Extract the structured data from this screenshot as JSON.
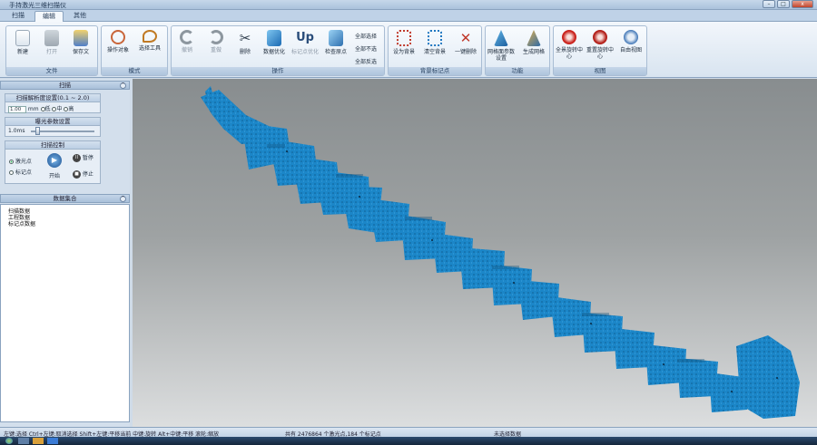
{
  "window": {
    "title": "手持激光三维扫描仪",
    "min": "–",
    "max": "□",
    "close": "x"
  },
  "tabs": [
    {
      "label": "扫描"
    },
    {
      "label": "编辑"
    },
    {
      "label": "其他"
    }
  ],
  "ribbon": {
    "groups": {
      "file": "文件",
      "mode": "模式",
      "operate": "操作",
      "bgmark": "背景标记点",
      "function": "功能",
      "view": "视图"
    },
    "file": {
      "new": "新建",
      "open": "打开",
      "save": "保存文"
    },
    "mode": {
      "operate_object": "操作对象",
      "select_tool": "选择工具"
    },
    "operate": {
      "undo": "撤销",
      "redo": "重做",
      "delete": "删除",
      "optimize": "数据优化",
      "mark_optimize": "标记点优化",
      "detect_prime": "检查原点",
      "full_select": "全部选择",
      "full_invert": "全部不选",
      "full_reverse": "全部反选"
    },
    "bgmark": {
      "set_bg": "设为背景",
      "clear_bg": "清空背景",
      "one_delete": "一键删除"
    },
    "function": {
      "grid_params": "网格面参数设置",
      "gen_grid": "生成网格"
    },
    "view": {
      "rotate_center": "全景旋转中心",
      "set_rotate": "重置旋转中心",
      "self_view": "自由视图"
    }
  },
  "left": {
    "scan_header": "扫描",
    "resolution": {
      "title": "扫描解析度设置(0.1 ~ 2.0)",
      "value": "1.00",
      "unit": "mm",
      "opt_low": "低",
      "opt_mid": "中",
      "opt_high": "高"
    },
    "exposure": {
      "title": "曝光参数设置",
      "value": "1.0ms"
    },
    "control": {
      "title": "扫描控制",
      "laser": "激光点",
      "mark": "标记点",
      "start": "开始",
      "pause": "暂停",
      "stop": "停止"
    },
    "data_header": "数据集合",
    "tree": [
      "扫描数据",
      "工程数据",
      "标记点数据"
    ]
  },
  "status": {
    "hint": "左键:选择 Ctrl+左键:取消选择 Shift+左键:平移当前 中键:旋转 Alt+中键:平移 滚轮:缩放",
    "points": "共有 2476864 个激光点,184 个标记点",
    "selection": "未选择数据"
  },
  "colors": {
    "cloud": "#1b86c8",
    "accent": "#2f5f95"
  }
}
